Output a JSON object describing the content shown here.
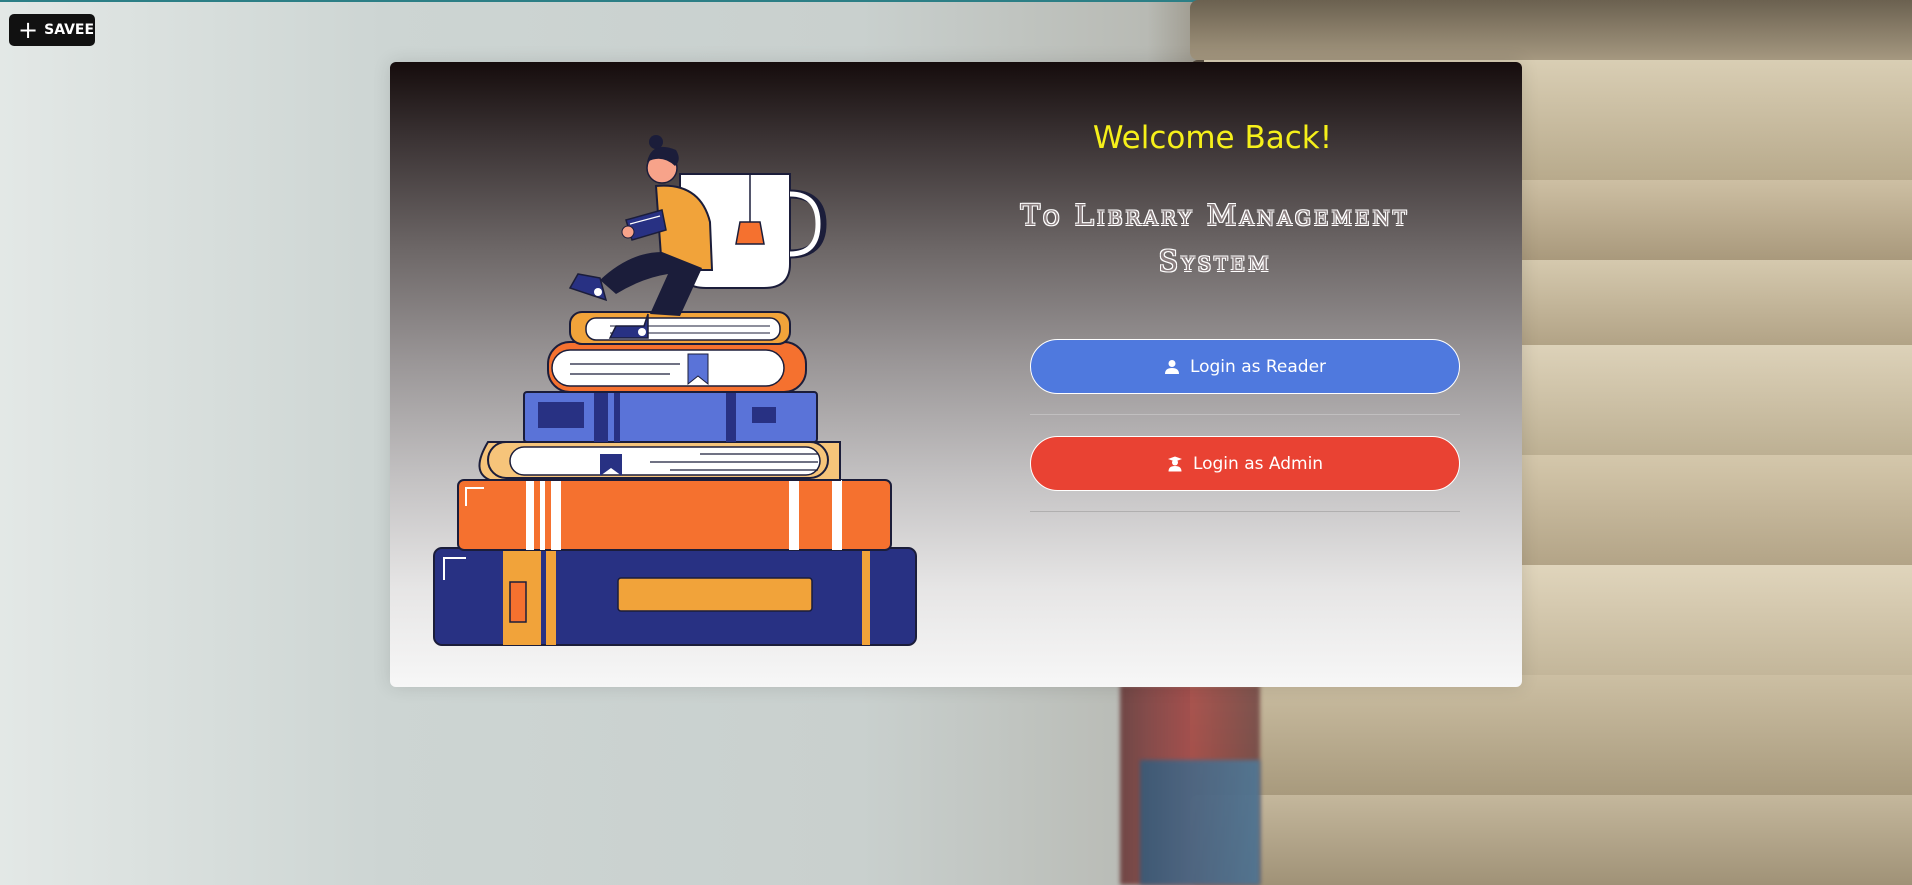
{
  "toolbar": {
    "savee_label": "SAVEE"
  },
  "card": {
    "welcome": "Welcome Back!",
    "subtitle": "To Library Management System",
    "reader_button": "Login as Reader",
    "admin_button": "Login as Admin"
  },
  "colors": {
    "welcome_text": "#f6f01a",
    "reader_button": "#4f79de",
    "admin_button": "#e94233",
    "toolbar_bg": "#111111"
  },
  "icons": {
    "savee": "plus-icon",
    "reader": "user-icon",
    "admin": "user-graduate-icon"
  }
}
